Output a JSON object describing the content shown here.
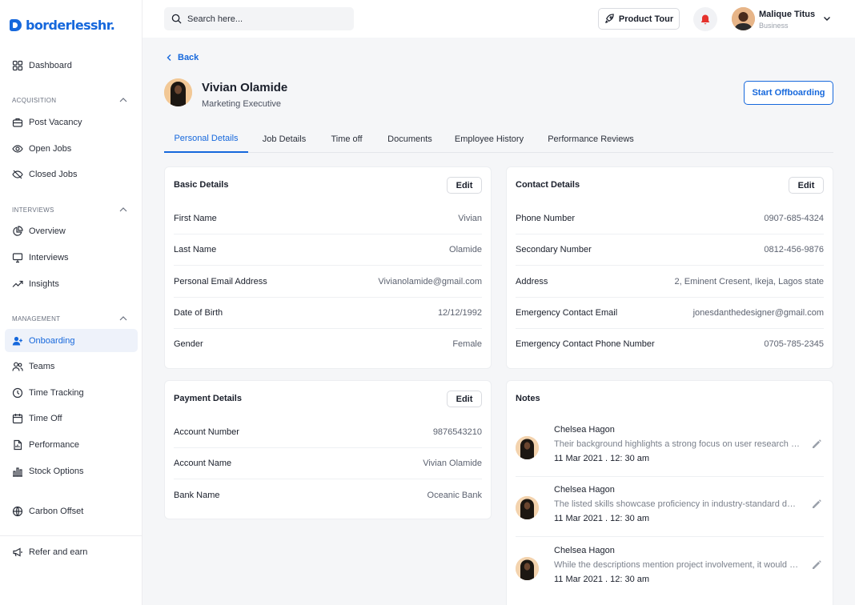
{
  "brand": {
    "logo_text": "borderlesshr.",
    "accent": "#1668dc"
  },
  "search": {
    "placeholder": "Search here..."
  },
  "topbar": {
    "product_tour_label": "Product Tour",
    "user_name": "Malique Titus",
    "user_role": "Business"
  },
  "sidebar": {
    "dashboard": "Dashboard",
    "sections": {
      "acquisition": "ACQUISITION",
      "interviews": "INTERVIEWS",
      "management": "MANAGEMENT"
    },
    "acquisition_items": [
      "Post Vacancy",
      "Open Jobs",
      "Closed Jobs"
    ],
    "interview_items": [
      "Overview",
      "Interviews",
      "Insights"
    ],
    "management_items": [
      "Onboarding",
      "Teams",
      "Time Tracking",
      "Time Off",
      "Performance",
      "Stock Options"
    ],
    "carbon_offset": "Carbon Offset",
    "refer": "Refer and earn",
    "active_item": "Onboarding"
  },
  "page": {
    "back_label": "Back",
    "employee_name": "Vivian Olamide",
    "employee_role": "Marketing Executive",
    "offboard_label": "Start Offboarding"
  },
  "tabs": [
    "Personal Details",
    "Job Details",
    "Time off",
    "Documents",
    "Employee History",
    "Performance Reviews"
  ],
  "active_tab": "Personal Details",
  "basic_details": {
    "title": "Basic Details",
    "edit_label": "Edit",
    "rows": [
      {
        "label": "First Name",
        "value": "Vivian"
      },
      {
        "label": "Last Name",
        "value": "Olamide"
      },
      {
        "label": "Personal Email Address",
        "value": "Vivianolamide@gmail.com"
      },
      {
        "label": "Date of Birth",
        "value": "12/12/1992"
      },
      {
        "label": "Gender",
        "value": "Female"
      }
    ]
  },
  "contact_details": {
    "title": "Contact Details",
    "edit_label": "Edit",
    "rows": [
      {
        "label": "Phone Number",
        "value": "0907-685-4324"
      },
      {
        "label": "Secondary Number",
        "value": "0812-456-9876"
      },
      {
        "label": "Address",
        "value": "2, Eminent Cresent, Ikeja, Lagos state"
      },
      {
        "label": "Emergency Contact Email",
        "value": "jonesdanthedesigner@gmail.com"
      },
      {
        "label": "Emergency Contact Phone Number",
        "value": "0705-785-2345"
      }
    ]
  },
  "payment_details": {
    "title": "Payment Details",
    "edit_label": "Edit",
    "rows": [
      {
        "label": "Account Number",
        "value": "9876543210"
      },
      {
        "label": "Account Name",
        "value": "Vivian Olamide"
      },
      {
        "label": "Bank Name",
        "value": "Oceanic Bank"
      }
    ]
  },
  "notes": {
    "title": "Notes",
    "items": [
      {
        "author": "Chelsea Hagon",
        "text": "Their background highlights a strong focus on user research and usability testing",
        "date": "11 Mar 2021 . 12: 30 am"
      },
      {
        "author": "Chelsea Hagon",
        "text": "The listed skills showcase proficiency in industry-standard design tools",
        "date": "11 Mar 2021 . 12: 30 am"
      },
      {
        "author": "Chelsea Hagon",
        "text": "While the descriptions mention project involvement, it would be helpful to see outcomes",
        "date": "11 Mar 2021 . 12: 30 am"
      }
    ]
  }
}
